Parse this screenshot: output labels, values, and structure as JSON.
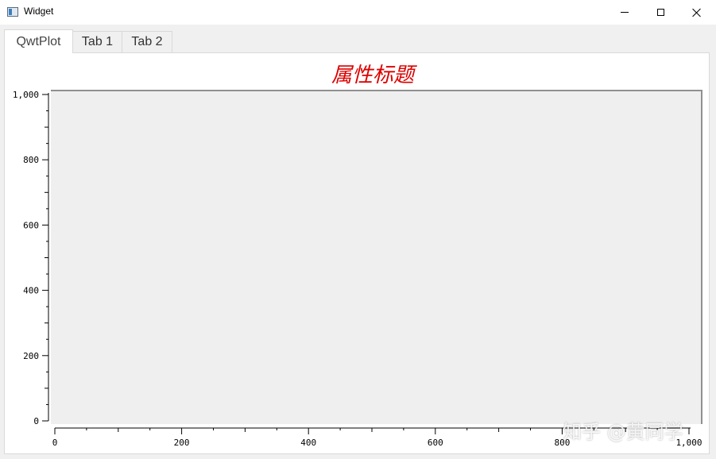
{
  "window": {
    "title": "Widget",
    "icon": "app-window-icon",
    "buttons": [
      "minimize-icon",
      "maximize-icon",
      "close-icon"
    ]
  },
  "tabs": [
    {
      "label": "QwtPlot",
      "active": true
    },
    {
      "label": "Tab 1",
      "active": false
    },
    {
      "label": "Tab 2",
      "active": false
    }
  ],
  "watermark": "知乎 @黄同学",
  "chart_data": {
    "type": "scatter",
    "title": "属性标题",
    "title_color": "#dd0000",
    "canvas_color": "#efefef",
    "xlabel": "",
    "ylabel": "",
    "xlim": [
      0,
      1000
    ],
    "ylim": [
      0,
      1000
    ],
    "x_ticks": [
      0,
      200,
      400,
      600,
      800,
      1000
    ],
    "y_ticks": [
      0,
      200,
      400,
      600,
      800,
      1000
    ],
    "x_tick_labels": [
      "0",
      "200",
      "400",
      "600",
      "800",
      "1,000"
    ],
    "y_tick_labels": [
      "0",
      "200",
      "400",
      "600",
      "800",
      "1,000"
    ],
    "minor_tick_step": 50,
    "grid": false,
    "series": []
  }
}
